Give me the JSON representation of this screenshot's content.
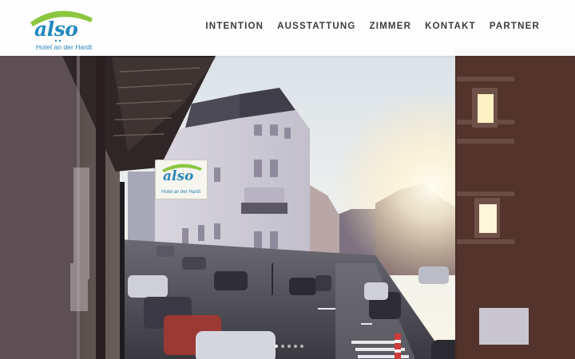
{
  "brand": {
    "name": "also",
    "subtitle": "Hotel an der Hardt",
    "colors": {
      "primary": "#2489bf",
      "accent": "#8cc63f"
    }
  },
  "nav": {
    "items": [
      {
        "label": "INTENTION"
      },
      {
        "label": "AUSSTATTUNG"
      },
      {
        "label": "ZIMMER"
      },
      {
        "label": "KONTAKT"
      },
      {
        "label": "PARTNER"
      }
    ]
  },
  "hero": {
    "sign_name": "also",
    "sign_subtitle": "Hotel an der Hardt",
    "slides_count": 5,
    "active_slide": 1
  }
}
